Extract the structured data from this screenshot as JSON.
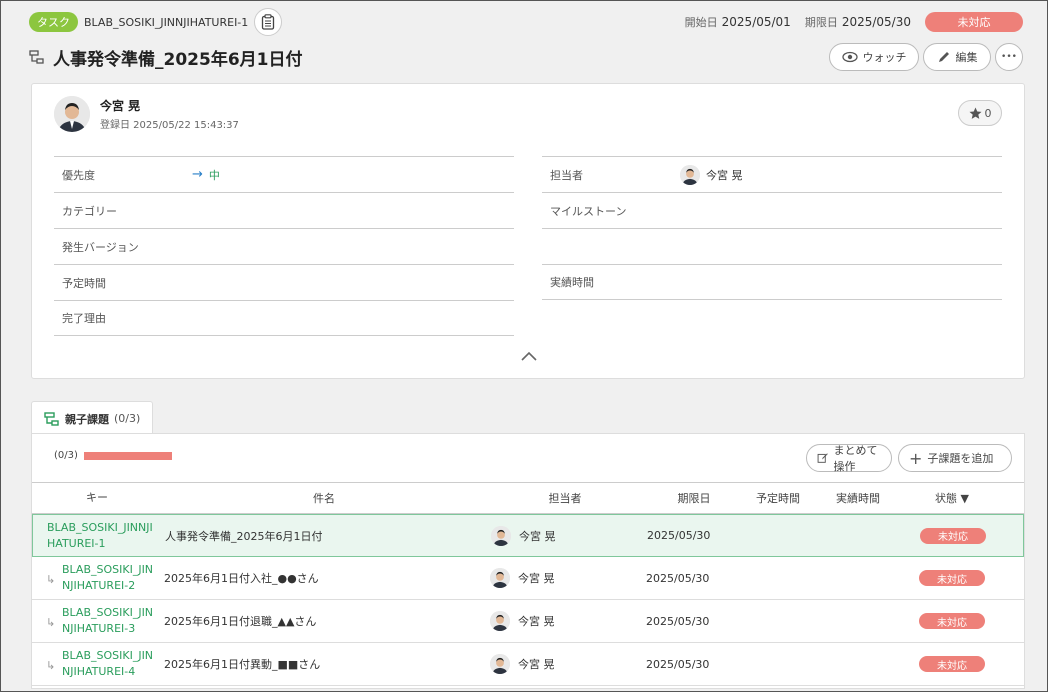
{
  "header": {
    "type_badge": "タスク",
    "issue_key": "BLAB_SOSIKI_JINNJIHATUREI-1",
    "start_label": "開始日",
    "start_date": "2025/05/01",
    "due_label": "期限日",
    "due_date": "2025/05/30",
    "status": "未対応",
    "title": "人事発令準備_2025年6月1日付",
    "watch_label": "ウォッチ",
    "edit_label": "編集",
    "more_label": "•••"
  },
  "reporter": {
    "name": "今宮 晃",
    "registered": "登録日 2025/05/22 15:43:37",
    "star_count": "0"
  },
  "fields_left": [
    {
      "label": "優先度",
      "value": "中"
    },
    {
      "label": "カテゴリー",
      "value": ""
    },
    {
      "label": "発生バージョン",
      "value": ""
    },
    {
      "label": "予定時間",
      "value": ""
    },
    {
      "label": "完了理由",
      "value": ""
    }
  ],
  "fields_right": [
    {
      "label": "担当者",
      "value": "今宮 晃"
    },
    {
      "label": "マイルストーン",
      "value": ""
    },
    {
      "label": "",
      "value": ""
    },
    {
      "label": "実績時間",
      "value": ""
    }
  ],
  "tab": {
    "label": "親子課題",
    "count": "(0/3)"
  },
  "panel": {
    "progress": "(0/3)",
    "progress_fraction": 0,
    "bulk_label": "まとめて操作",
    "add_child_label": "子課題を追加"
  },
  "table": {
    "headers": {
      "key": "キー",
      "subject": "件名",
      "assignee": "担当者",
      "due": "期限日",
      "planned": "予定時間",
      "actual": "実績時間",
      "status": "状態 ▼"
    },
    "rows": [
      {
        "key": "BLAB_SOSIKI_JINNJI\nHATUREI-1",
        "subject": "人事発令準備_2025年6月1日付",
        "assignee": "今宮 晃",
        "due": "2025/05/30",
        "planned": "",
        "actual": "",
        "status": "未対応"
      },
      {
        "key": "BLAB_SOSIKI_JIN\nNJIHATUREI-2",
        "subject": "2025年6月1日付入社_●●さん",
        "assignee": "今宮 晃",
        "due": "2025/05/30",
        "planned": "",
        "actual": "",
        "status": "未対応"
      },
      {
        "key": "BLAB_SOSIKI_JIN\nNJIHATUREI-3",
        "subject": "2025年6月1日付退職_▲▲さん",
        "assignee": "今宮 晃",
        "due": "2025/05/30",
        "planned": "",
        "actual": "",
        "status": "未対応"
      },
      {
        "key": "BLAB_SOSIKI_JIN\nNJIHATUREI-4",
        "subject": "2025年6月1日付異動_■■さん",
        "assignee": "今宮 晃",
        "due": "2025/05/30",
        "planned": "",
        "actual": "",
        "status": "未対応"
      }
    ]
  },
  "colors": {
    "accent_green": "#2a9d5c",
    "status_red": "#ee8079",
    "badge_green": "#8cc63f"
  }
}
